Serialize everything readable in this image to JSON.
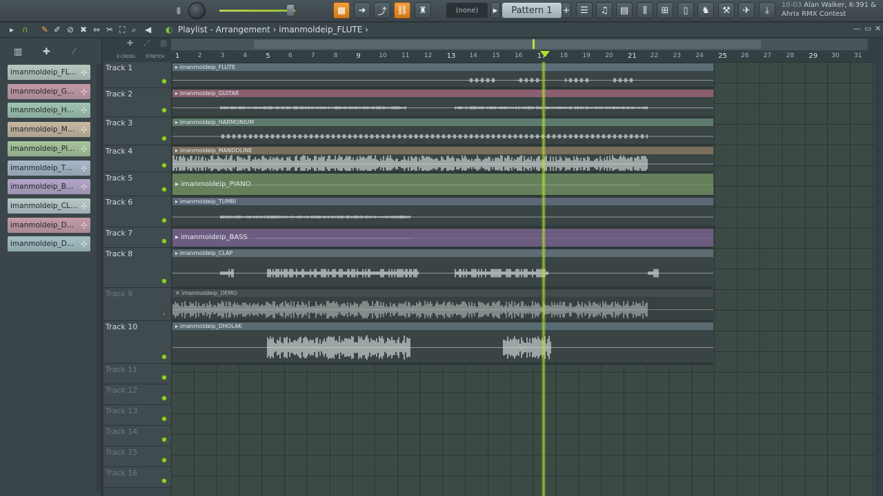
{
  "toolbar": {
    "pattern_selector": "(none)",
    "pattern_name": "Pattern 1",
    "song_info_num": "10-03",
    "song_info_line1": "Alan Walker, K-391 &",
    "song_info_line2": "Ahrix RMX Contest",
    "icons": [
      "mixer-icon",
      "arrow-right-icon",
      "curve-icon",
      "link-icon",
      "stamp-icon",
      "piano-icon",
      "channel-rack-icon",
      "plugin-icon",
      "browser-icon",
      "download-icon"
    ]
  },
  "window": {
    "title_prefix": "Playlist - Arrangement",
    "title_sep": "›",
    "title_clip": "imanmoldeip_FLUTE",
    "title_arrow": "›"
  },
  "browser": {
    "clips": [
      {
        "label": "imanmoldeip_FLUTE",
        "color": "#b8c8c0"
      },
      {
        "label": "imanmoldeip_GUITAR",
        "color": "#c49aa8"
      },
      {
        "label": "imanmoldeip_HARM...",
        "color": "#9fc4b0"
      },
      {
        "label": "imanmoldeip_MAND...",
        "color": "#c8b8a0"
      },
      {
        "label": "imanmoldeip_PIANO",
        "color": "#a8c49a"
      },
      {
        "label": "imanmoldeip_TUMBI",
        "color": "#a8b8c8"
      },
      {
        "label": "imanmoldeip_BASS",
        "color": "#b4a4c8"
      },
      {
        "label": "imanmoldeip_CLAP",
        "color": "#b8c8c8"
      },
      {
        "label": "imanmoldeip_DEMO",
        "color": "#c49aa8"
      },
      {
        "label": "imanmoldeip_DHOLAK",
        "color": "#a4c0c4"
      }
    ]
  },
  "ruler": {
    "labels": [
      "Z-CROSS",
      "STRETCH"
    ],
    "bars": [
      "1",
      "2",
      "3",
      "4",
      "5",
      "6",
      "7",
      "8",
      "9",
      "10",
      "11",
      "12",
      "13",
      "14",
      "15",
      "16",
      "17",
      "18",
      "19",
      "20",
      "21",
      "22",
      "23",
      "24",
      "25",
      "26",
      "27",
      "28",
      "29",
      "30",
      "31"
    ]
  },
  "tracks": [
    {
      "name": "Track 1",
      "clip": "imanmoldeip_FLUTE",
      "color": "#5b6e78"
    },
    {
      "name": "Track 2",
      "clip": "imanmoldeip_GUITAR",
      "color": "#8a6070"
    },
    {
      "name": "Track 3",
      "clip": "imanmoldeip_HARMONIUM",
      "color": "#5e7a6c"
    },
    {
      "name": "Track 4",
      "clip": "imanmoldeip_MANDOLINE",
      "color": "#7a6e5c"
    },
    {
      "name": "Track 5",
      "clip": "imanmoldeip_PIANO",
      "color": "#66805c"
    },
    {
      "name": "Track 6",
      "clip": "imanmoldeip_TUMBI",
      "color": "#5c6876"
    },
    {
      "name": "Track 7",
      "clip": "imanmoldeip_BASS",
      "color": "#6c5c80"
    },
    {
      "name": "Track 8",
      "clip": "imanmoldeip_CLAP",
      "color": "#5e6c74"
    },
    {
      "name": "Track 9",
      "clip": "imanmoldeip_DEMO",
      "color": "#4a5254"
    },
    {
      "name": "Track 10",
      "clip": "imanmoldeip_DHOLAK",
      "color": "#5a6c72"
    },
    {
      "name": "Track 11"
    },
    {
      "name": "Track 12"
    },
    {
      "name": "Track 13"
    },
    {
      "name": "Track 14"
    },
    {
      "name": "Track 15"
    },
    {
      "name": "Track 16"
    }
  ],
  "colors": {
    "playhead": "#b8e020",
    "accent": "#f0a040"
  }
}
